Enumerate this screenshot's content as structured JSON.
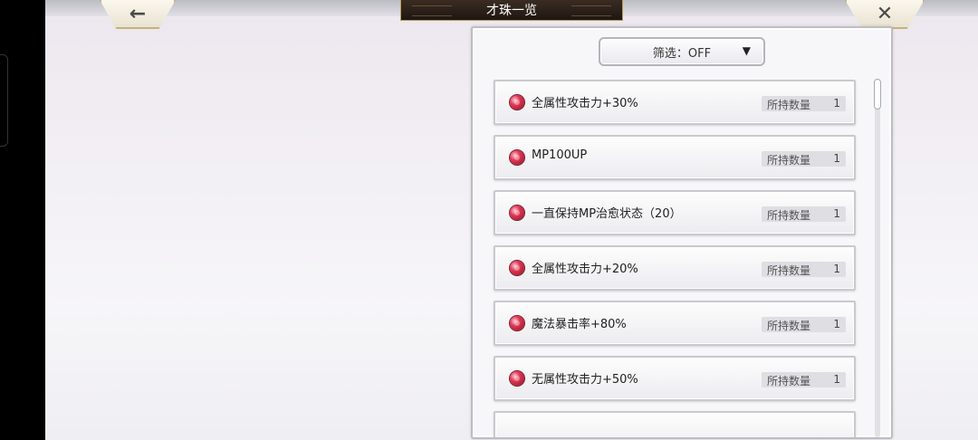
{
  "header": {
    "title": "才珠一览",
    "back_icon": "←",
    "close_icon": "✕"
  },
  "filter": {
    "label": "筛选：OFF",
    "caret": "▼"
  },
  "list": {
    "items": [
      {
        "name": "全属性攻击力+30%",
        "count_label": "所持数量",
        "count": "1"
      },
      {
        "name": "MP100UP",
        "count_label": "所持数量",
        "count": "1"
      },
      {
        "name": "一直保持MP治愈状态（20）",
        "count_label": "所持数量",
        "count": "1"
      },
      {
        "name": "全属性攻击力+20%",
        "count_label": "所持数量",
        "count": "1"
      },
      {
        "name": "魔法暴击率+80%",
        "count_label": "所持数量",
        "count": "1"
      },
      {
        "name": "无属性攻击力+50%",
        "count_label": "所持数量",
        "count": "1"
      }
    ]
  },
  "scroll_position": 0
}
